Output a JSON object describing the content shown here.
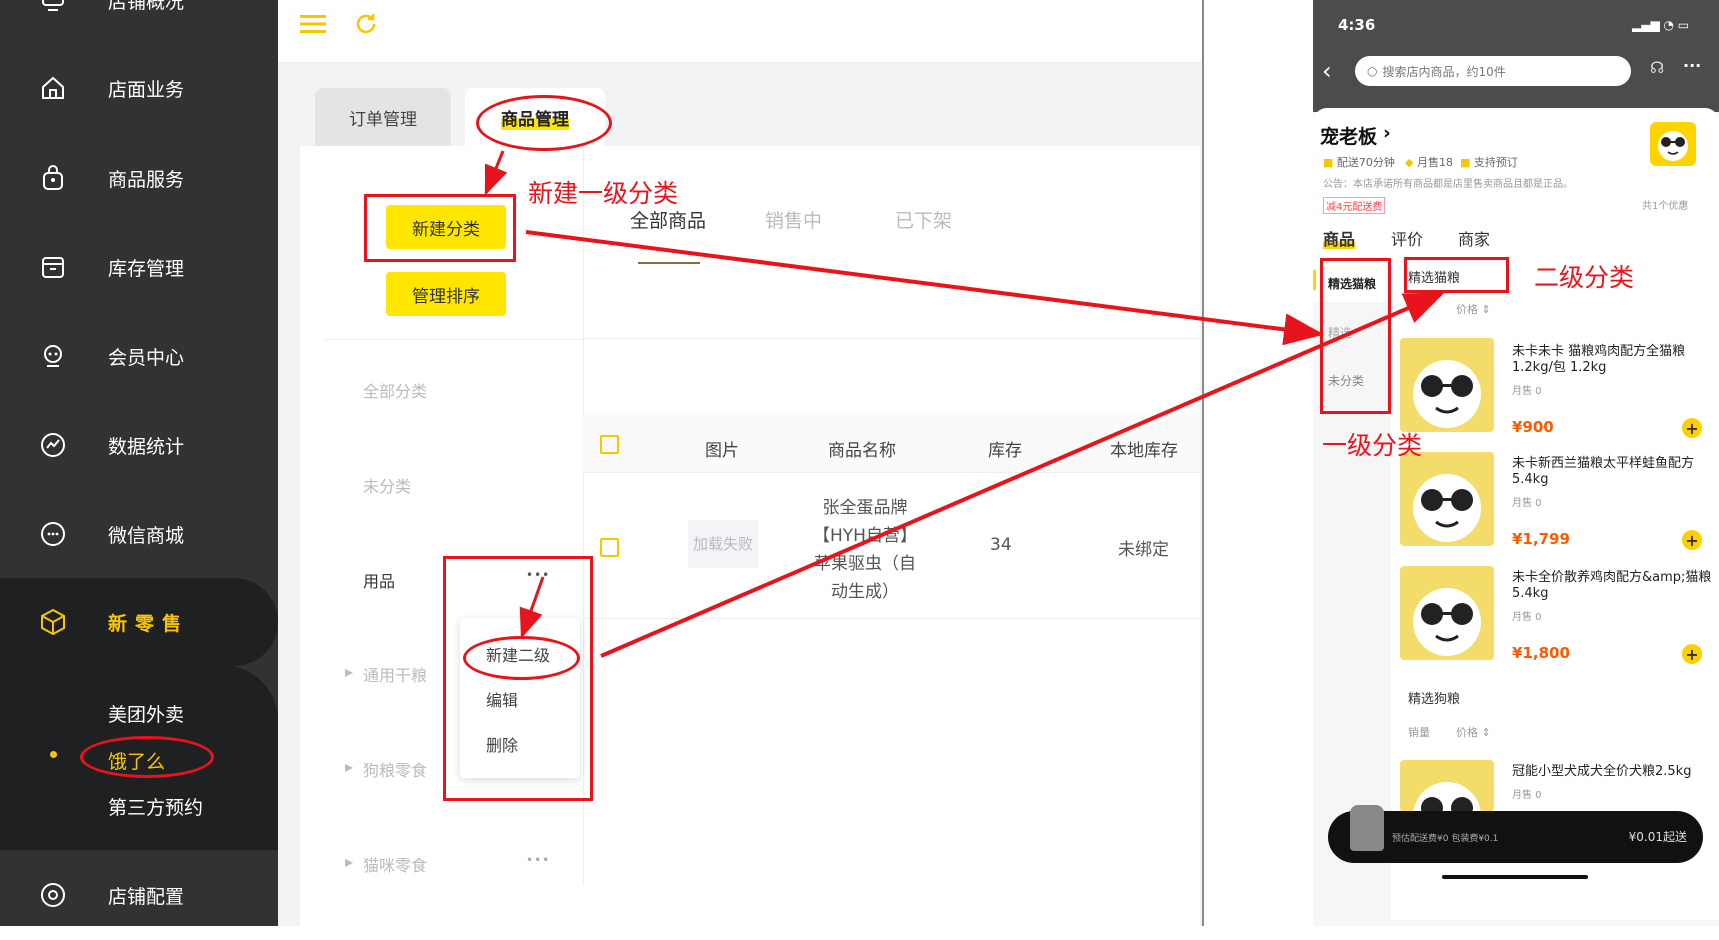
{
  "sidebar": {
    "items": [
      {
        "label": "店铺概况",
        "icon": "monitor-icon"
      },
      {
        "label": "店面业务",
        "icon": "home-icon"
      },
      {
        "label": "商品服务",
        "icon": "bag-icon"
      },
      {
        "label": "库存管理",
        "icon": "box-icon"
      },
      {
        "label": "会员中心",
        "icon": "member-icon"
      },
      {
        "label": "数据统计",
        "icon": "chart-icon"
      },
      {
        "label": "微信商城",
        "icon": "chat-icon"
      },
      {
        "label": "新零售",
        "icon": "cube-icon"
      },
      {
        "label": "店铺配置",
        "icon": "settings-icon"
      }
    ],
    "subitems": [
      "美团外卖",
      "饿了么",
      "第三方预约"
    ]
  },
  "tabs": [
    "订单管理",
    "商品管理"
  ],
  "buttons": {
    "new_category": "新建分类",
    "manage_sort": "管理排序"
  },
  "categories": [
    "全部分类",
    "未分类",
    "用品",
    "通用干粮",
    "狗粮零食",
    "猫咪零食"
  ],
  "subtabs": [
    "全部商品",
    "销售中",
    "已下架"
  ],
  "table": {
    "headers": [
      "图片",
      "商品名称",
      "库存",
      "本地库存"
    ],
    "row": {
      "image": "加载失败",
      "name_lines": [
        "张全蛋品牌",
        "【HYH自营】",
        "苹果驱虫（自",
        "动生成）"
      ],
      "stock": "34",
      "local_stock": "未绑定"
    }
  },
  "context_menu": [
    "新建二级",
    "编辑",
    "删除"
  ],
  "more_dots": "•••",
  "annotations": {
    "first_new": "新建一级分类",
    "second": "二级分类",
    "first": "一级分类"
  },
  "phone": {
    "time": "4:36",
    "search_placeholder": "搜索店内商品，约10件",
    "store_name": "宠老板",
    "delivery": "配送70分钟",
    "monthly": "月售18",
    "preorder": "支持预订",
    "notice": "公告：本店承诺所有商品都是店里售卖商品且都是正品。",
    "discount": "减4元配送费",
    "discount_count": "共1个优惠",
    "tabs": [
      "商品",
      "评价",
      "商家"
    ],
    "left_cats": [
      "精选猫粮",
      "精选",
      "未分类"
    ],
    "section1": "精选猫粮",
    "sort_price": "价格",
    "products": [
      {
        "name": "未卡未卡 猫粮鸡肉配方全猫粮1.2kg/包 1.2kg",
        "sales": "月售 0",
        "price": "¥900"
      },
      {
        "name": "未卡新西兰猫粮太平样蛙鱼配方5.4kg",
        "sales": "月售 0",
        "price": "¥1,799"
      },
      {
        "name": "未卡全价散养鸡肉配方&amp;猫粮 5.4kg",
        "sales": "月售 0",
        "price": "¥1,800"
      }
    ],
    "section2": "精选狗粮",
    "sort_sales": "销量",
    "product4": {
      "name": "冠能小型犬成犬全价犬粮2.5kg",
      "sales": "月售 0"
    },
    "cart_fee": "预估配送费¥0 包装费¥0.1",
    "cart_min": "¥0.01起送"
  }
}
